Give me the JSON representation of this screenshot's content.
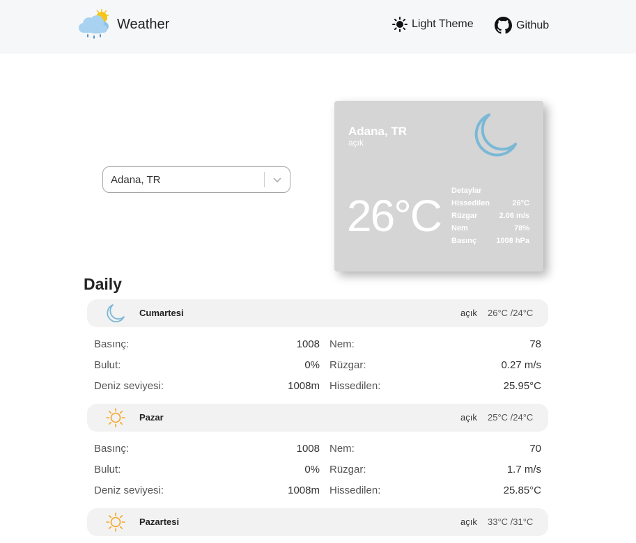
{
  "header": {
    "title": "Weather",
    "logo_icon": "cloud-sun-rain-icon",
    "theme_label": "Light Theme",
    "theme_icon": "sun-icon",
    "github_label": "Github",
    "github_icon": "github-icon"
  },
  "search": {
    "value": "Adana, TR",
    "chevron_icon": "chevron-down-icon"
  },
  "current": {
    "city": "Adana, TR",
    "description": "açık",
    "temperature": "26°C",
    "icon": "moon-icon",
    "details_title": "Detaylar",
    "details": [
      {
        "label": "Hissedilen",
        "value": "26°C"
      },
      {
        "label": "Rüzgar",
        "value": "2.06 m/s"
      },
      {
        "label": "Nem",
        "value": "78%"
      },
      {
        "label": "Basınç",
        "value": "1008 hPa"
      }
    ]
  },
  "daily": {
    "title": "Daily",
    "days": [
      {
        "name": "Cumartesi",
        "description": "açık",
        "temps": "26°C /24°C",
        "icon": "moon-icon",
        "rows": [
          {
            "l1": "Basınç:",
            "v1": "1008",
            "l2": "Nem:",
            "v2": "78"
          },
          {
            "l1": "Bulut:",
            "v1": "0%",
            "l2": "Rüzgar:",
            "v2": "0.27 m/s"
          },
          {
            "l1": "Deniz seviyesi:",
            "v1": "1008m",
            "l2": "Hissedilen:",
            "v2": "25.95°C"
          }
        ]
      },
      {
        "name": "Pazar",
        "description": "açık",
        "temps": "25°C /24°C",
        "icon": "sun-icon",
        "rows": [
          {
            "l1": "Basınç:",
            "v1": "1008",
            "l2": "Nem:",
            "v2": "70"
          },
          {
            "l1": "Bulut:",
            "v1": "0%",
            "l2": "Rüzgar:",
            "v2": "1.7 m/s"
          },
          {
            "l1": "Deniz seviyesi:",
            "v1": "1008m",
            "l2": "Hissedilen:",
            "v2": "25.85°C"
          }
        ]
      },
      {
        "name": "Pazartesi",
        "description": "açık",
        "temps": "33°C /31°C",
        "icon": "sun-icon",
        "rows": []
      }
    ]
  },
  "colors": {
    "card_bg": "#d5d5d5",
    "moon": "#7ab8d6",
    "sun_orange": "#f5a623",
    "header_bg": "#f6f7f9"
  }
}
